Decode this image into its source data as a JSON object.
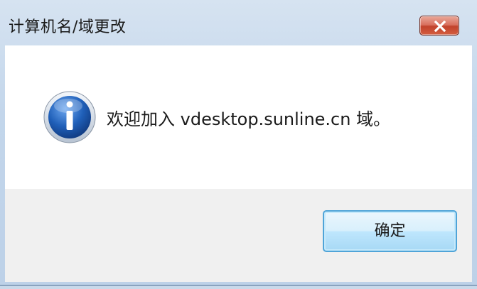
{
  "dialog": {
    "title": "计算机名/域更改",
    "message": "欢迎加入 vdesktop.sunline.cn 域。",
    "ok_label": "确定",
    "close_icon": "close-icon",
    "info_icon": "info-icon"
  },
  "colors": {
    "title_gradient_top": "#d6e3f1",
    "close_red": "#c2432c",
    "button_border": "#4fa4d8",
    "icon_blue": "#1f5fb8"
  }
}
